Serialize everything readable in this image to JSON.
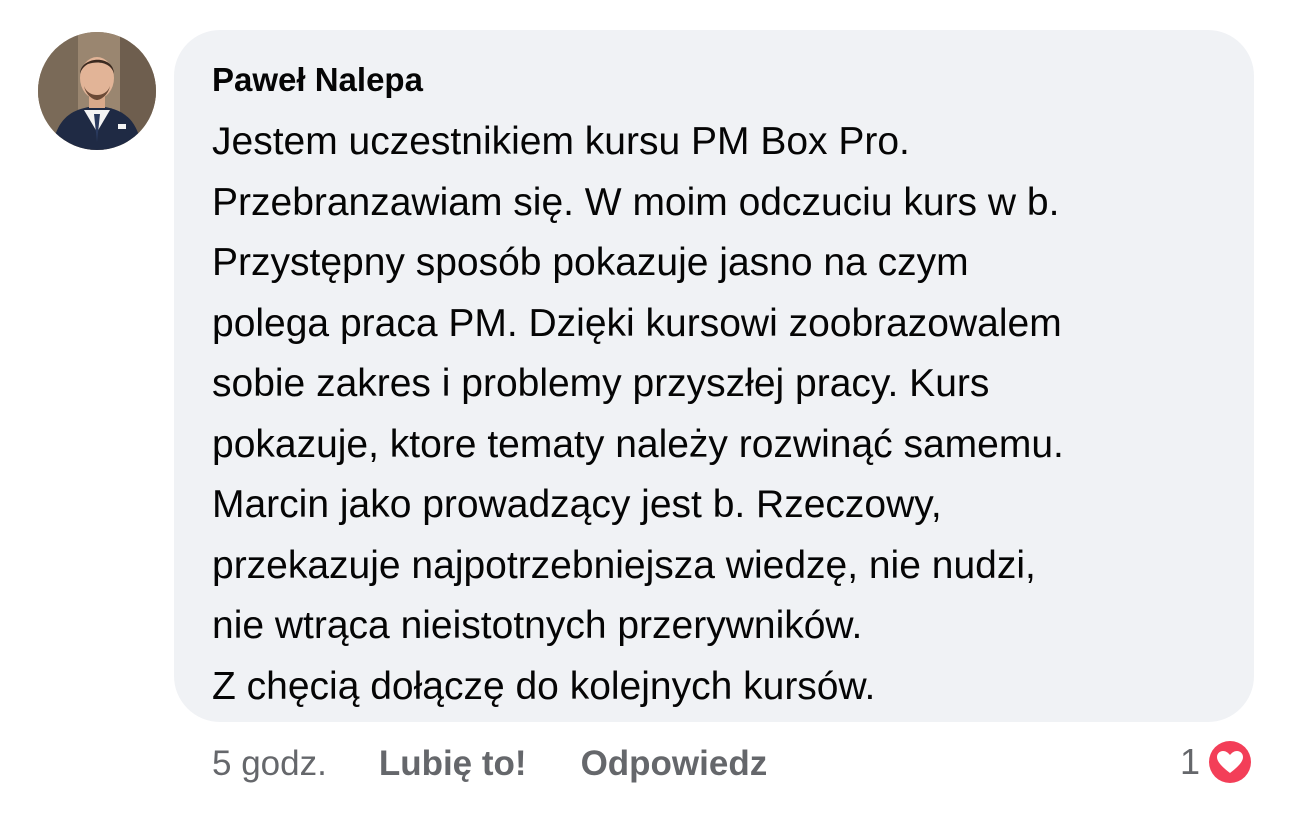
{
  "comment": {
    "author": "Paweł Nalepa",
    "text_lines": [
      "Jestem uczestnikiem kursu PM Box Pro.",
      "Przebranzawiam się. W moim odczuciu kurs w b.",
      "Przystępny sposób pokazuje jasno na czym",
      "polega praca PM. Dzięki kursowi zoobrazowalem",
      "sobie zakres i problemy przyszłej pracy. Kurs",
      "pokazuje, ktore tematy należy rozwinąć samemu.",
      "Marcin jako prowadzący jest b. Rzeczowy,",
      "przekazuje najpotrzebniejsza wiedzę, nie nudzi,",
      "nie wtrąca nieistotnych przerywników.",
      "Z chęcią dołączę do kolejnych kursów."
    ]
  },
  "actions": {
    "time": "5 godz.",
    "like_label": "Lubię to!",
    "reply_label": "Odpowiedz"
  },
  "reactions": {
    "count": "1",
    "icon": "heart-icon",
    "color": "#f33e58"
  },
  "colors": {
    "bubble": "#f0f2f5",
    "text": "#050505",
    "secondary": "#65676b"
  }
}
